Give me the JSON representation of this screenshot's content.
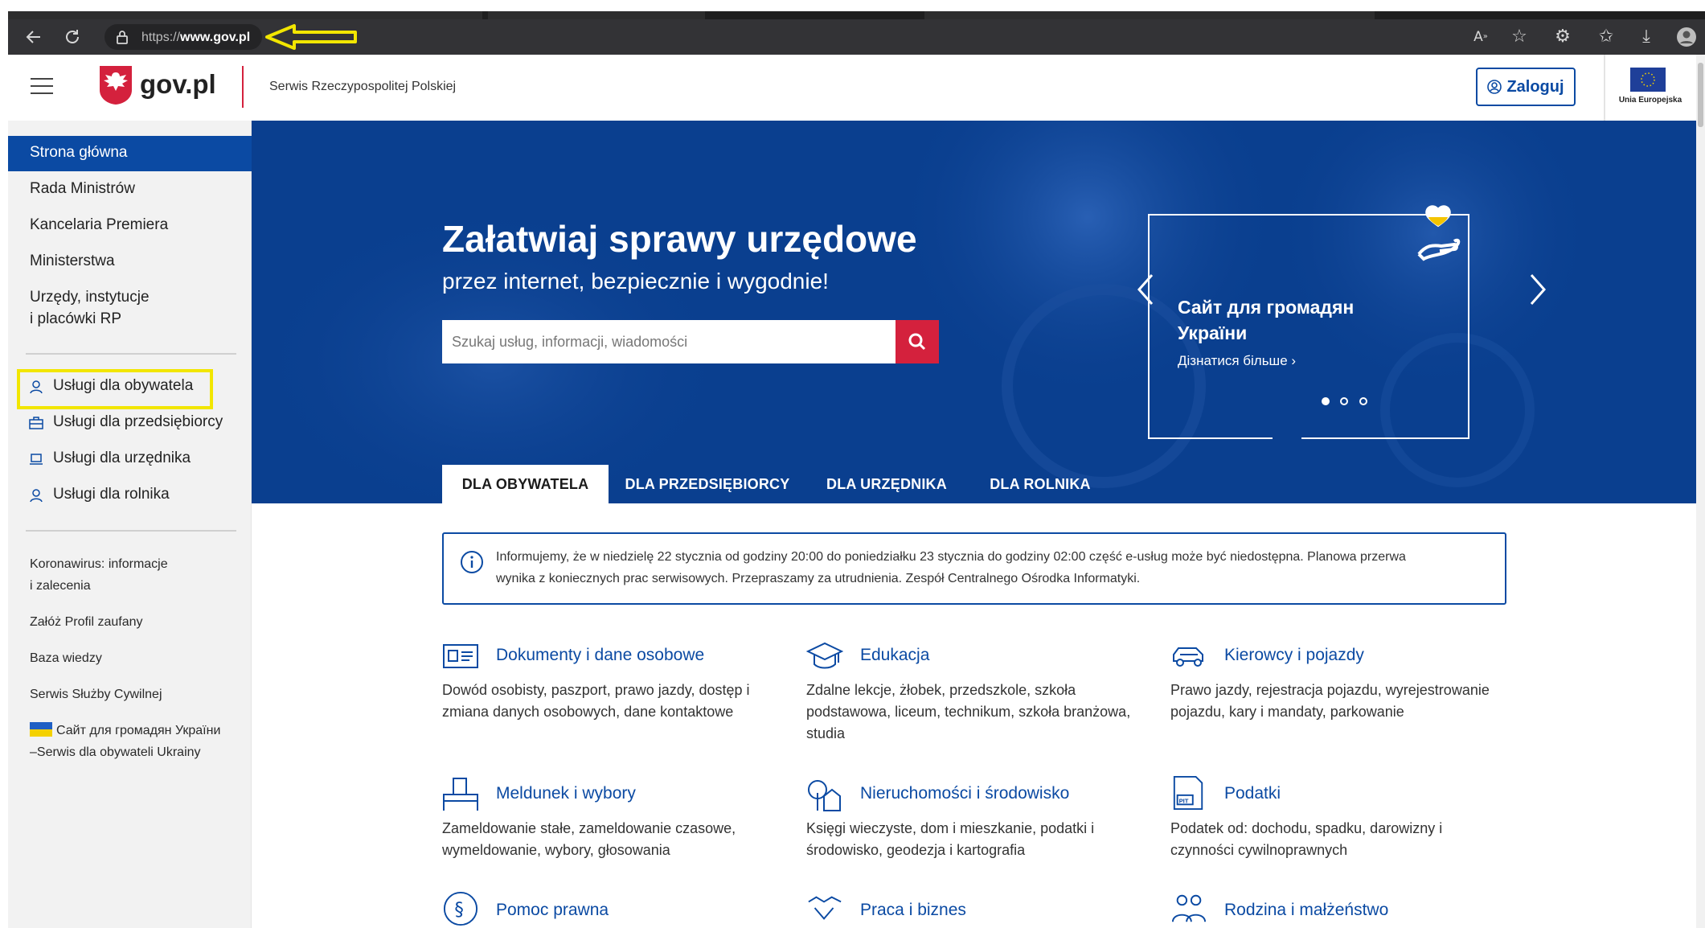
{
  "browser": {
    "url_prefix": "https://",
    "url_domain": "www.gov.pl",
    "icons": [
      "back-icon",
      "reload-icon",
      "lock-icon",
      "read-aloud-icon",
      "favorite-add-icon",
      "extensions-icon",
      "favorites-icon",
      "download-icon",
      "profile-icon"
    ]
  },
  "header": {
    "brand": "gov.pl",
    "subtitle": "Serwis Rzeczypospolitej Polskiej",
    "login_label": "Zaloguj",
    "eu_label": "Unia Europejska"
  },
  "sidebar": {
    "main_items": [
      "Strona główna",
      "Rada Ministrów",
      "Kancelaria Premiera",
      "Ministerstwa"
    ],
    "urzedy_line1": "Urzędy, instytucje",
    "urzedy_line2": "i placówki RP",
    "services": [
      "Usługi dla obywatela",
      "Usługi dla przedsiębiorcy",
      "Usługi dla urzędnika",
      "Usługi dla rolnika"
    ],
    "extra_line1": "Koronawirus: informacje",
    "extra_line2": "i zalecenia",
    "extra_items": [
      "Załóż Profil zaufany",
      "Baza wiedzy",
      "Serwis Służby Cywilnej"
    ],
    "ukraine_line1": "Сайт для громадян України",
    "ukraine_line2": "–Serwis dla obywateli Ukrainy"
  },
  "hero": {
    "title": "Załatwiaj sprawy urzędowe",
    "subtitle": "przez internet, bezpiecznie i wygodnie!",
    "search_placeholder": "Szukaj usług, informacji, wiadomości",
    "carousel": {
      "title_line1": "Сайт для громадян",
      "title_line2": "України",
      "link": "Дізнатися більше ›",
      "dots_total": 3,
      "active_dot": 1
    }
  },
  "tabs": [
    "DLA OBYWATELA",
    "DLA PRZEDSIĘBIORCY",
    "DLA URZĘDNIKA",
    "DLA ROLNIKA"
  ],
  "notice": {
    "line1": "Informujemy, że w niedzielę 22 stycznia od godziny 20:00 do poniedziałku 23 stycznia do godziny 02:00 część e-usług może być niedostępna. Planowa przerwa",
    "line2": "wynika z koniecznych prac serwisowych. Przepraszamy za utrudnienia. Zespół Centralnego Ośrodka Informatyki."
  },
  "categories": [
    {
      "title": "Dokumenty i dane osobowe",
      "desc": "Dowód osobisty, paszport, prawo jazdy, dostęp i zmiana danych osobowych, dane kontaktowe"
    },
    {
      "title": "Edukacja",
      "desc": "Zdalne lekcje, żłobek, przedszkole, szkoła podstawowa, liceum, technikum, szkoła branżowa, studia"
    },
    {
      "title": "Kierowcy i pojazdy",
      "desc": "Prawo jazdy, rejestracja pojazdu, wyrejestrowanie pojazdu, kary i mandaty, parkowanie"
    },
    {
      "title": "Meldunek i wybory",
      "desc": "Zameldowanie stałe, zameldowanie czasowe, wymeldowanie, wybory, głosowania"
    },
    {
      "title": "Nieruchomości i środowisko",
      "desc": "Księgi wieczyste, dom i mieszkanie, podatki i środowisko, geodezja i kartografia"
    },
    {
      "title": "Podatki",
      "desc": "Podatek od: dochodu, spadku, darowizny i czynności cywilnoprawnych"
    },
    {
      "title": "Pomoc prawna",
      "desc": ""
    },
    {
      "title": "Praca i biznes",
      "desc": ""
    },
    {
      "title": "Rodzina i małżeństwo",
      "desc": ""
    }
  ],
  "annotations": {
    "highlight_color": "#f2e600"
  },
  "colors": {
    "brand_blue": "#0b4aa3",
    "nav_active": "#0b4aa3",
    "search_button": "#d4213d",
    "hero_blue": "#0a3f8f"
  }
}
